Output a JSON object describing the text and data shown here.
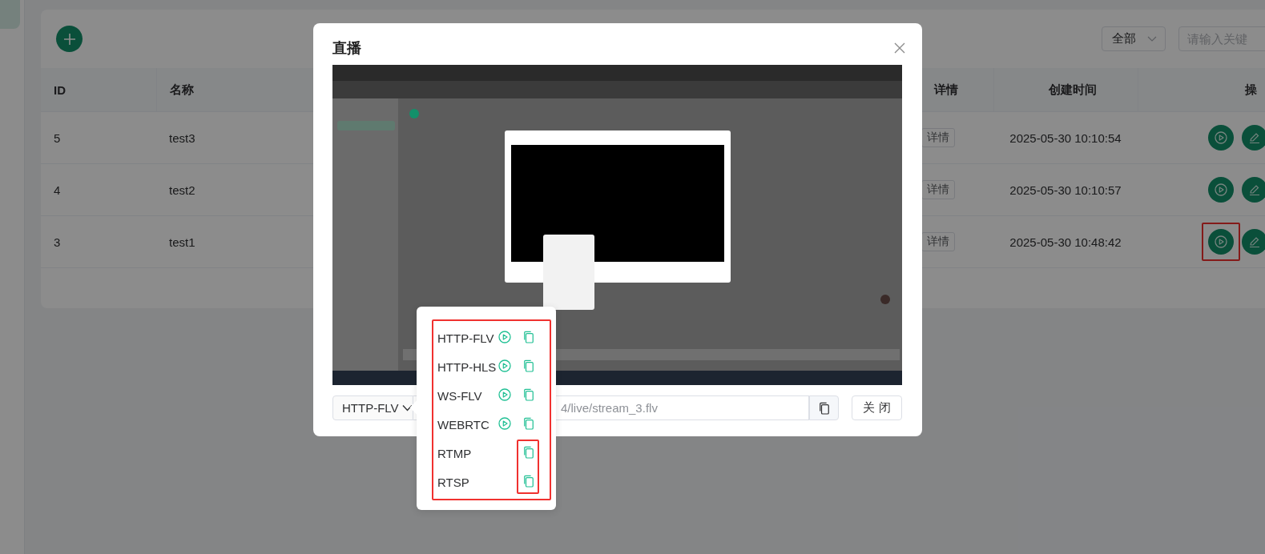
{
  "toolbar": {
    "filter_select": {
      "value": "全部"
    },
    "search": {
      "placeholder": "请输入关键"
    }
  },
  "table": {
    "columns": [
      "ID",
      "名称",
      "详情",
      "创建时间",
      "操"
    ],
    "rows": [
      {
        "id": "5",
        "name": "test3",
        "detail": "详情",
        "created": "2025-05-30 10:10:54",
        "highlighted": false
      },
      {
        "id": "4",
        "name": "test2",
        "detail": "详情",
        "created": "2025-05-30 10:10:57",
        "highlighted": false
      },
      {
        "id": "3",
        "name": "test1",
        "detail": "详情",
        "created": "2025-05-30 10:48:42",
        "highlighted": true
      }
    ]
  },
  "dialog": {
    "title": "直播",
    "protocol_select": {
      "value": "HTTP-FLV"
    },
    "url_field": {
      "value": "4/live/stream_3.flv"
    },
    "close_button": "关 闭",
    "protocol_menu": {
      "outlined": true,
      "items": [
        {
          "label": "HTTP-FLV",
          "playable": true,
          "highlighted": false
        },
        {
          "label": "HTTP-HLS",
          "playable": true,
          "highlighted": false
        },
        {
          "label": "WS-FLV",
          "playable": true,
          "highlighted": false
        },
        {
          "label": "WEBRTC",
          "playable": true,
          "highlighted": false
        },
        {
          "label": "RTMP",
          "playable": false,
          "highlighted": true
        },
        {
          "label": "RTSP",
          "playable": false,
          "highlighted": true
        }
      ]
    }
  }
}
